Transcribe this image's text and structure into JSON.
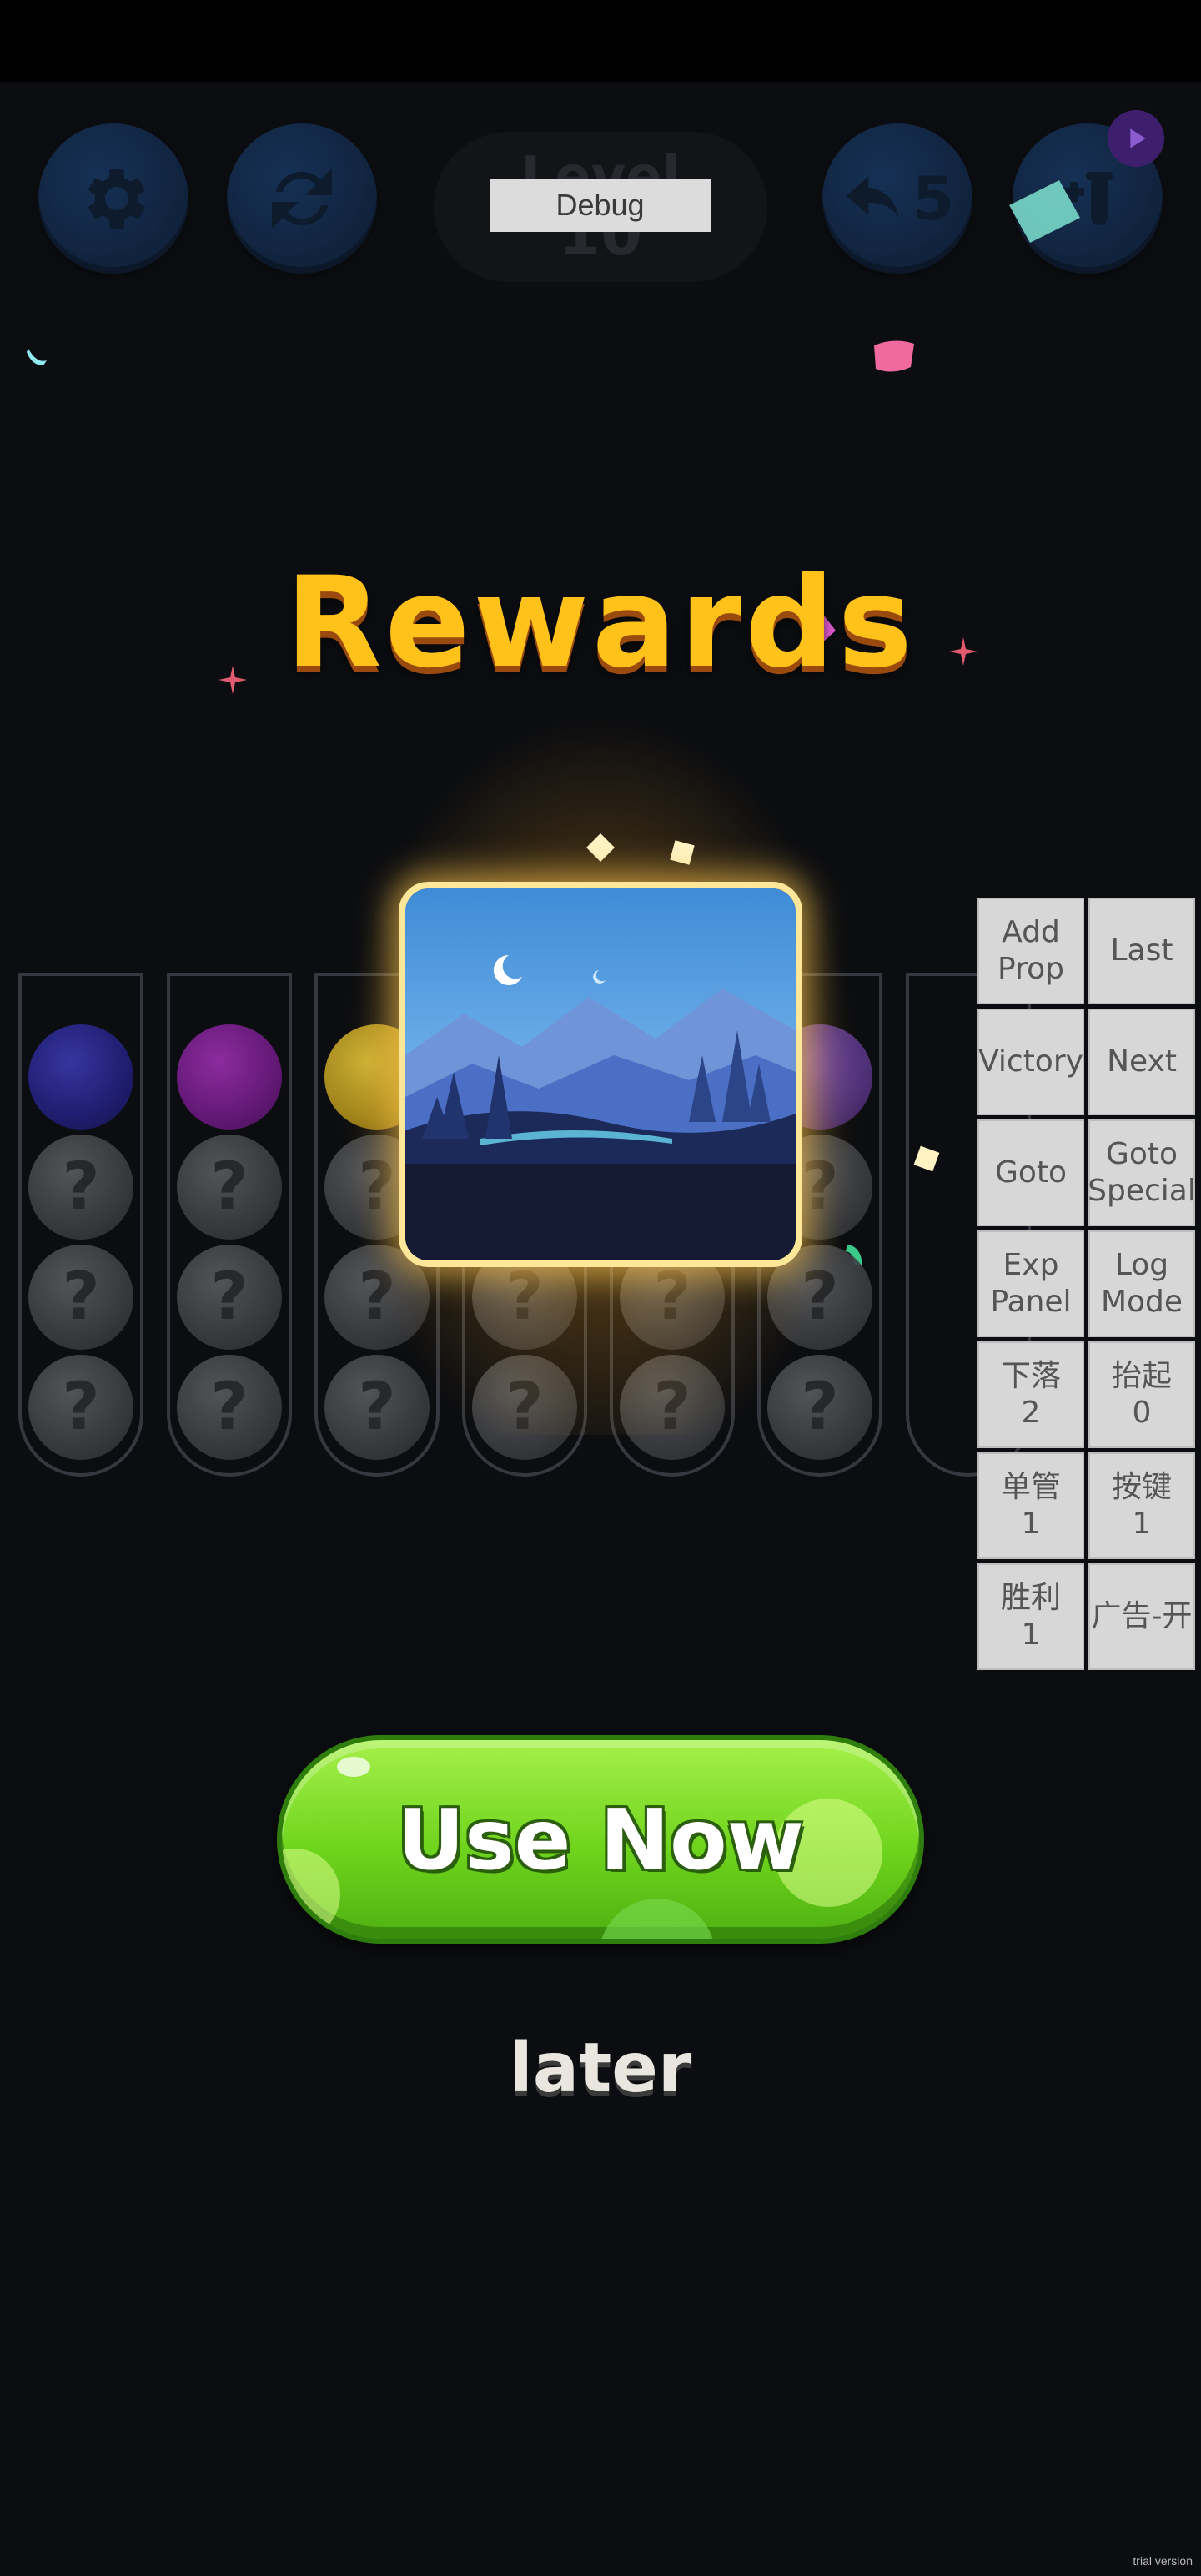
{
  "hud": {
    "settings_icon": "gear-icon",
    "restart_icon": "refresh-icon",
    "level_label": "Level",
    "level_number": "10",
    "debug_label": "Debug",
    "undo_count": "5",
    "undo_icon": "undo-arrow-icon",
    "add_tube_icon": "add-tube-icon",
    "video_badge_icon": "play-icon"
  },
  "reward": {
    "title": "Rewards",
    "card_image": "night-landscape-theme",
    "use_now_label": "Use Now",
    "later_label": "later"
  },
  "tubes": [
    {
      "balls": [
        "navy",
        "q",
        "q",
        "q"
      ]
    },
    {
      "balls": [
        "purple",
        "q",
        "q",
        "q"
      ]
    },
    {
      "balls": [
        "gold",
        "q",
        "q",
        "q"
      ]
    },
    {
      "balls": [
        "hidden",
        "hidden",
        "q",
        "q"
      ]
    },
    {
      "balls": [
        "hidden",
        "hidden",
        "q",
        "q"
      ]
    },
    {
      "balls": [
        "violet",
        "q",
        "q",
        "q"
      ]
    },
    {
      "balls": []
    }
  ],
  "debug_panel": {
    "buttons": [
      "Add\nProp",
      "Last",
      "Victory",
      "Next",
      "Goto",
      "Goto\nSpecial",
      "Exp\nPanel",
      "Log\nMode",
      "下落\n2",
      "抬起\n0",
      "单管\n1",
      "按键\n1",
      "胜利\n1",
      "广告-开"
    ]
  },
  "footer": {
    "trial_text": "trial version"
  },
  "colors": {
    "title": "#ffc21a",
    "use_now_green": "#6fd41c",
    "hud_blue": "#173a6b",
    "card_border": "#ffe79a"
  }
}
